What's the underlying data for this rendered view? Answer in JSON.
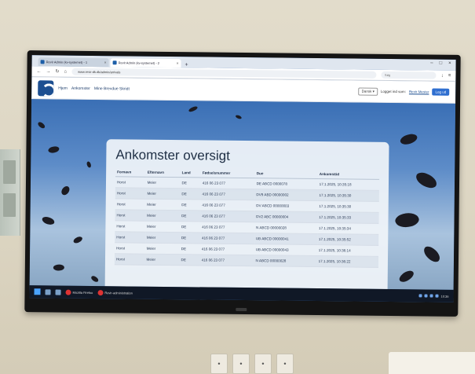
{
  "browser": {
    "tabs": [
      {
        "label": "Revir Admin (kv-systemet) - 1",
        "active": false
      },
      {
        "label": "Revir Admin (kv-systemet) - 2",
        "active": true
      }
    ],
    "url": "www.revir-dk.dk/admin/arrivals",
    "search_placeholder": "Søg"
  },
  "site": {
    "nav": [
      "Hjem",
      "Ankomster",
      "Mine Brevdue Skridt"
    ],
    "lang": "Dansk ▾",
    "logged_in_text": "Logget ind som:",
    "user": "Revir Mester",
    "logout": "Log ud"
  },
  "card": {
    "title": "Ankomster oversigt",
    "columns": [
      "Fornavn",
      "Efternavn",
      "Land",
      "Fødselsnummer",
      "Due",
      "Ankomsttid"
    ],
    "rows": [
      [
        "Horst",
        "Meier",
        "DE",
        "416 06 23 077",
        "DE ABCD 0000078",
        "17.1.2025, 10:35:18"
      ],
      [
        "Horst",
        "Meier",
        "DE",
        "416 06 23 077",
        "DV9 ABD 00000002",
        "17.1.2025, 10:35:30"
      ],
      [
        "Horst",
        "Meier",
        "DE",
        "416 06 23 077",
        "DV ABCD 00000003",
        "17.1.2025, 10:35:30"
      ],
      [
        "Horst",
        "Meier",
        "DE",
        "416 06 23 077",
        "DV2 ABC 00000004",
        "17.1.2025, 10:35:33"
      ],
      [
        "Horst",
        "Meier",
        "DE",
        "416 06 23 077",
        "N ABCD 00000028",
        "17.1.2025, 10:35:34"
      ],
      [
        "Horst",
        "Meier",
        "DE",
        "416 06 23 077",
        "UB ABCD 00000041",
        "17.1.2025, 10:35:52"
      ],
      [
        "Horst",
        "Meier",
        "DE",
        "416 06 23 077",
        "UB ABCD 00000043",
        "17.1.2025, 10:36:14"
      ],
      [
        "Horst",
        "Meier",
        "DE",
        "416 06 23 077",
        "N ABCD 00000028",
        "17.1.2025, 10:36:22"
      ]
    ]
  },
  "taskbar": {
    "apps": [
      "Mozilla Firefox",
      "Revir-administration"
    ],
    "clock": "10:36"
  },
  "colors": {
    "accent": "#2f6fd0",
    "logo": "#1d4f91",
    "taskbar": "#101826"
  }
}
